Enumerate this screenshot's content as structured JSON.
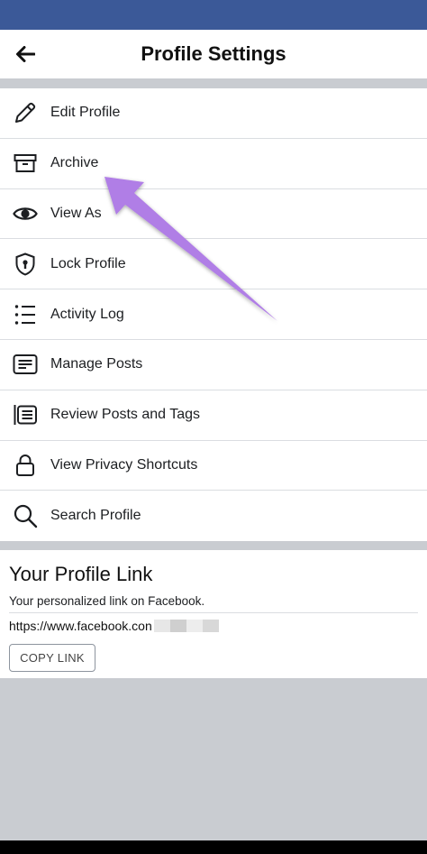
{
  "header": {
    "title": "Profile Settings"
  },
  "menu": {
    "items": [
      {
        "label": "Edit Profile",
        "icon": "pencil-icon"
      },
      {
        "label": "Archive",
        "icon": "archive-box-icon"
      },
      {
        "label": "View As",
        "icon": "eye-icon"
      },
      {
        "label": "Lock Profile",
        "icon": "shield-lock-icon"
      },
      {
        "label": "Activity Log",
        "icon": "list-icon"
      },
      {
        "label": "Manage Posts",
        "icon": "posts-icon"
      },
      {
        "label": "Review Posts and Tags",
        "icon": "review-posts-icon"
      },
      {
        "label": "View Privacy Shortcuts",
        "icon": "lock-icon"
      },
      {
        "label": "Search Profile",
        "icon": "search-icon"
      }
    ]
  },
  "profile_link": {
    "heading": "Your Profile Link",
    "description": "Your personalized link on Facebook.",
    "url": "https://www.facebook.con",
    "copy_label": "COPY LINK"
  },
  "colors": {
    "status_bar": "#3b5998",
    "separator": "#c9ccd1",
    "annotation_arrow": "#b07ee6"
  }
}
